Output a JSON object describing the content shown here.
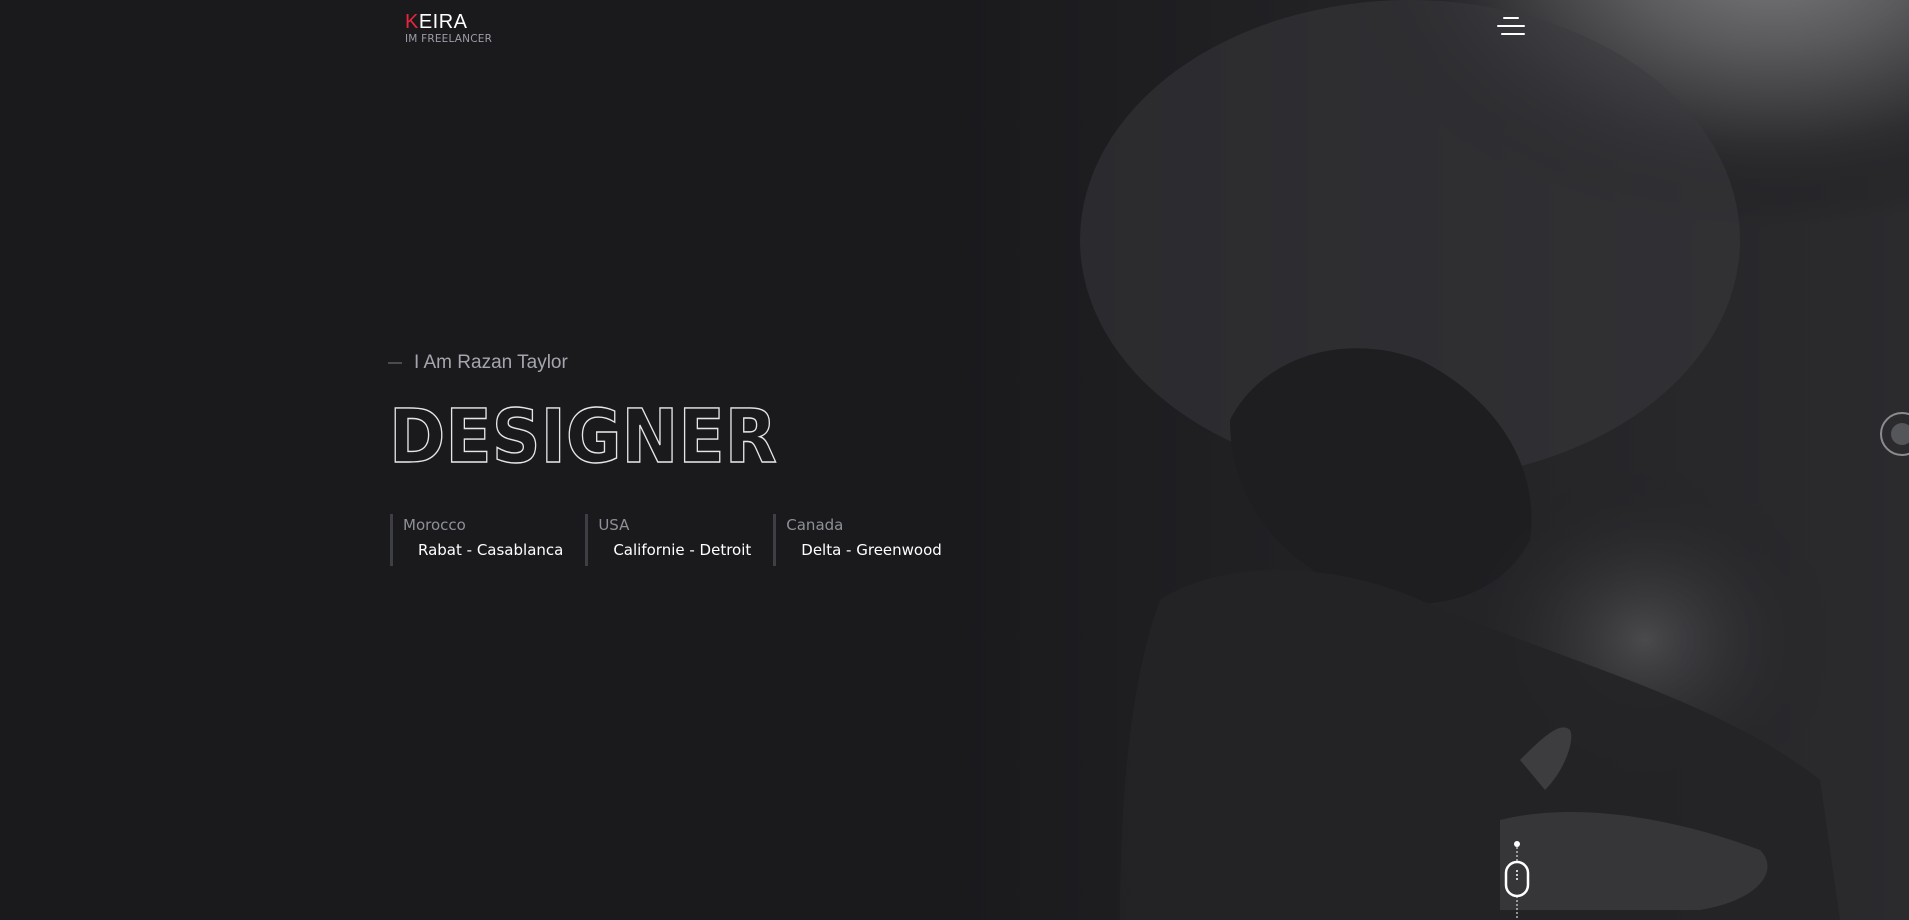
{
  "brand": {
    "initial": "K",
    "rest": "EIRA",
    "tagline": "IM FREELANCER"
  },
  "header": {
    "menu_icon": "hamburger-menu-icon"
  },
  "hero": {
    "intro": "I Am Razan Taylor",
    "title": "DESIGNER",
    "locations": [
      {
        "country": "Morocco",
        "cities": "Rabat - Casablanca"
      },
      {
        "country": "USA",
        "cities": "Californie - Detroit"
      },
      {
        "country": "Canada",
        "cities": "Delta - Greenwood"
      }
    ]
  },
  "colors": {
    "background": "#1a1a1d",
    "accent": "#e8253c",
    "text_primary": "#ffffff",
    "text_muted": "#8d9097"
  },
  "icons": {
    "menu": "hamburger-menu-icon",
    "scroll": "mouse-scroll-icon",
    "side": "circle-side-button-icon"
  }
}
